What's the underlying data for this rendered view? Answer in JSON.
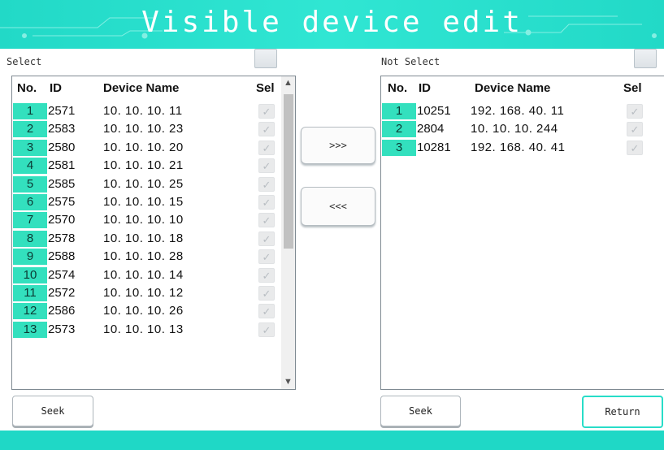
{
  "header": {
    "title": "Visible device edit"
  },
  "colors": {
    "accent": "#22d9c7",
    "row_number_bg": "#33e0be",
    "return_border": "#28ddc8"
  },
  "left_panel": {
    "label": "Select",
    "columns": {
      "no": "No.",
      "id": "ID",
      "name": "Device Name",
      "sel": "Sel"
    },
    "rows": [
      {
        "no": "1",
        "id": "2571",
        "name": "10. 10. 10. 11"
      },
      {
        "no": "2",
        "id": "2583",
        "name": "10. 10. 10. 23"
      },
      {
        "no": "3",
        "id": "2580",
        "name": "10. 10. 10. 20"
      },
      {
        "no": "4",
        "id": "2581",
        "name": "10. 10. 10. 21"
      },
      {
        "no": "5",
        "id": "2585",
        "name": "10. 10. 10. 25"
      },
      {
        "no": "6",
        "id": "2575",
        "name": "10. 10. 10. 15"
      },
      {
        "no": "7",
        "id": "2570",
        "name": "10. 10. 10. 10"
      },
      {
        "no": "8",
        "id": "2578",
        "name": "10. 10. 10. 18"
      },
      {
        "no": "9",
        "id": "2588",
        "name": "10. 10. 10. 28"
      },
      {
        "no": "10",
        "id": "2574",
        "name": "10. 10. 10. 14"
      },
      {
        "no": "11",
        "id": "2572",
        "name": "10. 10. 10. 12"
      },
      {
        "no": "12",
        "id": "2586",
        "name": "10. 10. 10. 26"
      },
      {
        "no": "13",
        "id": "2573",
        "name": "10. 10. 10. 13"
      }
    ],
    "seek_label": "Seek"
  },
  "right_panel": {
    "label": "Not Select",
    "columns": {
      "no": "No.",
      "id": "ID",
      "name": "Device Name",
      "sel": "Sel"
    },
    "rows": [
      {
        "no": "1",
        "id": "10251",
        "name": "192. 168. 40. 11"
      },
      {
        "no": "2",
        "id": "2804",
        "name": "10. 10. 10. 244"
      },
      {
        "no": "3",
        "id": "10281",
        "name": "192. 168. 40. 41"
      }
    ],
    "seek_label": "Seek",
    "return_label": "Return"
  },
  "transfer": {
    "move_right_label": ">>>",
    "move_left_label": "<<<"
  },
  "icons": {
    "check": "checkmark-icon",
    "scroll_up": "chevron-up-icon",
    "scroll_down": "chevron-down-icon"
  }
}
